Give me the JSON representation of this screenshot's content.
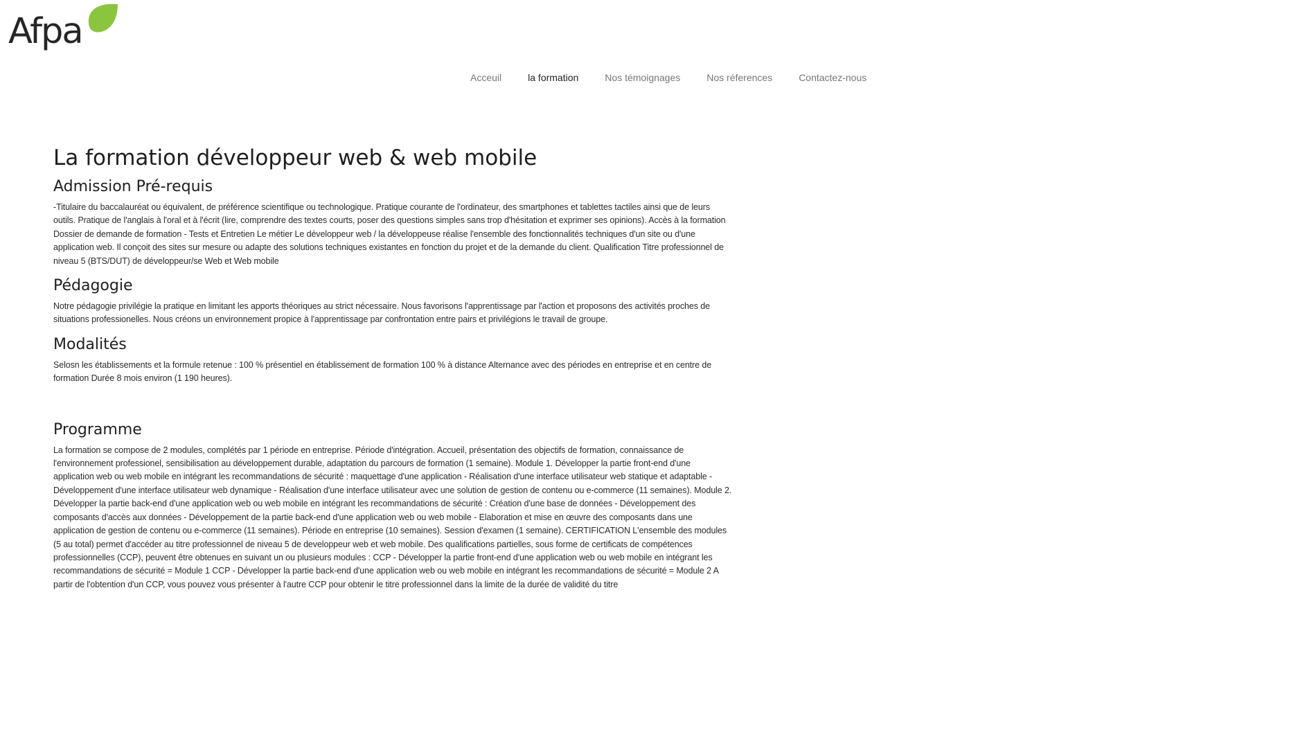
{
  "header": {
    "logo_text": "Afpa",
    "brand_color": "#8bc53f"
  },
  "nav": {
    "items": [
      {
        "label": "Acceuil",
        "active": false
      },
      {
        "label": "la formation",
        "active": true
      },
      {
        "label": "Nos témoignages",
        "active": false
      },
      {
        "label": "Nos réferences",
        "active": false
      },
      {
        "label": "Contactez-nous",
        "active": false
      }
    ]
  },
  "main": {
    "title": "La formation développeur web & web mobile",
    "sections": [
      {
        "heading": "Admission Pré-requis",
        "text": "-Titulaire du baccalauréat ou équivalent, de préférence scientifique ou technologique. Pratique courante de l'ordinateur, des smartphones et tablettes tactiles ainsi que de leurs outils. Pratique de l'anglais à l'oral et à l'écrit (lire, comprendre des textes courts, poser des questions simples sans trop d'hésitation et exprimer ses opinions). Accès à la formation Dossier de demande de formation - Tests et Entretien Le métier Le développeur web / la développeuse réalise l'ensemble des fonctionnalités techniques d'un site ou d'une application web. Il conçoit des sites sur mesure ou adapte des solutions techniques existantes en fonction du projet et de la demande du client. Qualification Titre professionnel de niveau 5 (BTS/DUT) de développeur/se Web et Web mobile"
      },
      {
        "heading": "Pédagogie",
        "text": "Notre pédagogie privilégie la pratique en limitant les apports théoriques au strict nécessaire. Nous favorisons l'apprentissage par l'action et proposons des activités proches de situations professionelles. Nous créons un environnement propice à l'apprentissage par confrontation entre pairs et privilégions le travail de groupe."
      },
      {
        "heading": "Modalités",
        "text": "Selosn les établissements et la formule retenue : 100 % présentiel en établissement de formation 100 % à distance Alternance avec des périodes en entreprise et en centre de formation Durée 8 mois environ (1 190 heures)."
      },
      {
        "heading": "Programme",
        "text": "La formation se compose de 2 modules, complétés par 1 période en entreprise. Période d'intégration. Accueil, présentation des objectifs de formation, connaissance de l'environnement professionel, sensibilisation au développement durable, adaptation du parcours de formation (1 semaine). Module 1. Développer la partie front-end d'une application web ou web mobile en intégrant les recommandations de sécurité : maquettage d'une application - Réalisation d'une interface utilisateur web statique et adaptable - Développement d'une interface utilisateur web dynamique - Réalisation d'une interface utilisateur avec une solution de gestion de contenu ou e-commerce (11 semaines). Module 2. Développer la partie back-end d'une application web ou web mobile en intégrant les recommandations de sécurité : Création d'une base de données - Développement des composants d'accès aux données - Développement de la partie back-end d'une application web ou web mobile - Elaboration et mise en œuvre des composants dans une application de gestion de contenu ou e-commerce (11 semaines). Période en entreprise (10 semaines). Session d'examen (1 semaine). CERTIFICATION L'ensemble des modules (5 au total) permet d'accéder au titre professionnel de niveau 5 de developpeur web et web mobile. Des qualifications partielles, sous forme de certificats de compétences professionnelles (CCP), peuvent être obtenues en suivant un ou plusieurs modules : CCP - Développer la partie front-end d'une application web ou web mobile en intégrant les recommandations de sécurité = Module 1 CCP - Développer la partie back-end d'une application web ou web mobile en intégrant les recommandations de sécurité = Module 2 A partir de l'obtention d'un CCP, vous pouvez vous présenter à l'autre CCP pour obtenir le titre professionnel dans la limite de la durée de validité du titre"
      }
    ]
  }
}
